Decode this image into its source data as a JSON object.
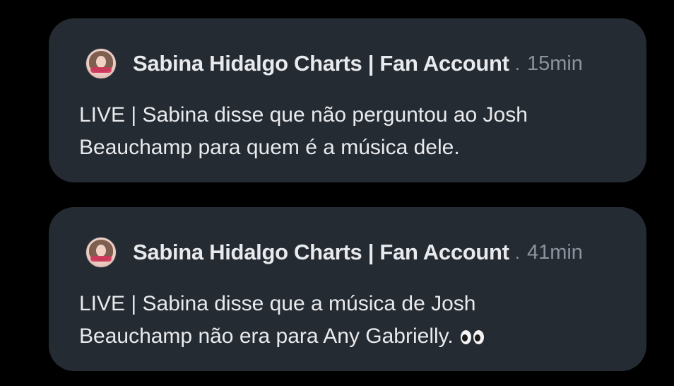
{
  "notifications": [
    {
      "author": "Sabina Hidalgo Charts | Fan Account",
      "separator": ".",
      "time": "15min",
      "line1": "LIVE | Sabina disse que não perguntou ao Josh",
      "line2": "Beauchamp para quem é a música dele.",
      "avatar_icon": "profile-avatar-icon"
    },
    {
      "author": "Sabina Hidalgo Charts | Fan Account",
      "separator": ".",
      "time": "41min",
      "line1": "LIVE | Sabina disse que a música de Josh",
      "line2": "Beauchamp não era para Any Gabrielly.",
      "avatar_icon": "profile-avatar-icon",
      "emoji_icon": "eyes-emoji-icon"
    }
  ],
  "colors": {
    "background": "#000000",
    "card": "#252b32",
    "primary_text": "#e8eaed",
    "secondary_text": "#8b949e"
  }
}
